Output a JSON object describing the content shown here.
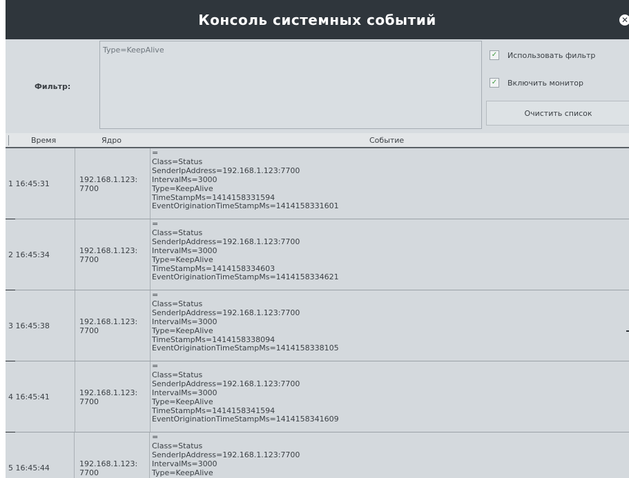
{
  "window": {
    "title": "Консоль системных событий"
  },
  "filter": {
    "label": "Фильтр:",
    "text": "Type=KeepAlive",
    "use_filter_label": "Использовать фильтр",
    "use_filter_checked": true,
    "enable_monitor_label": "Включить монитор",
    "enable_monitor_checked": true,
    "clear_button": "Очистить список"
  },
  "columns": {
    "time": "Время",
    "core": "Ядро",
    "event": "Событие"
  },
  "rows": [
    {
      "time": "1 16:45:31",
      "core_a": "192.168.1.123:",
      "core_b": "7700",
      "event": "=\nClass=Status\nSenderIpAddress=192.168.1.123:7700\nIntervalMs=3000\nType=KeepAlive\nTimeStampMs=1414158331594\nEventOriginationTimeStampMs=1414158331601"
    },
    {
      "time": "2 16:45:34",
      "core_a": "192.168.1.123:",
      "core_b": "7700",
      "event": "=\nClass=Status\nSenderIpAddress=192.168.1.123:7700\nIntervalMs=3000\nType=KeepAlive\nTimeStampMs=1414158334603\nEventOriginationTimeStampMs=1414158334621"
    },
    {
      "time": "3 16:45:38",
      "core_a": "192.168.1.123:",
      "core_b": "7700",
      "event": "=\nClass=Status\nSenderIpAddress=192.168.1.123:7700\nIntervalMs=3000\nType=KeepAlive\nTimeStampMs=1414158338094\nEventOriginationTimeStampMs=1414158338105"
    },
    {
      "time": "4 16:45:41",
      "core_a": "192.168.1.123:",
      "core_b": "7700",
      "event": "=\nClass=Status\nSenderIpAddress=192.168.1.123:7700\nIntervalMs=3000\nType=KeepAlive\nTimeStampMs=1414158341594\nEventOriginationTimeStampMs=1414158341609"
    },
    {
      "time": "5 16:45:44",
      "core_a": "192.168.1.123:",
      "core_b": "7700",
      "event": "=\nClass=Status\nSenderIpAddress=192.168.1.123:7700\nIntervalMs=3000\nType=KeepAlive"
    }
  ]
}
